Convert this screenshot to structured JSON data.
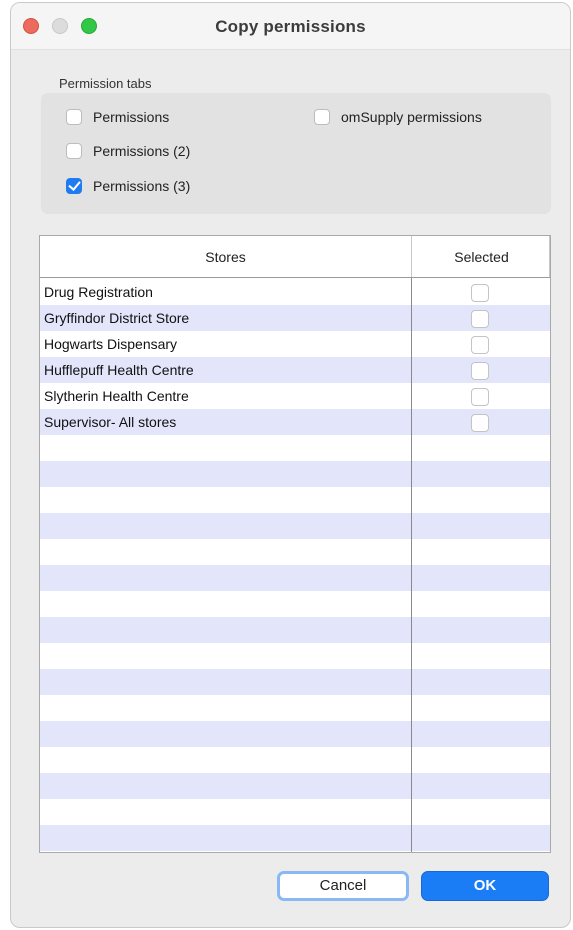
{
  "window": {
    "title": "Copy permissions"
  },
  "permission_tabs": {
    "label": "Permission tabs",
    "options": [
      {
        "label": "Permissions",
        "checked": false
      },
      {
        "label": "Permissions (2)",
        "checked": false
      },
      {
        "label": "Permissions (3)",
        "checked": true
      },
      {
        "label": "omSupply permissions",
        "checked": false
      }
    ]
  },
  "table": {
    "columns": [
      "Stores",
      "Selected"
    ],
    "rows": [
      {
        "store": "Drug Registration",
        "selected": false
      },
      {
        "store": "Gryffindor District Store",
        "selected": false
      },
      {
        "store": "Hogwarts Dispensary",
        "selected": false
      },
      {
        "store": "Hufflepuff Health Centre",
        "selected": false
      },
      {
        "store": "Slytherin Health Centre",
        "selected": false
      },
      {
        "store": "Supervisor- All stores",
        "selected": false
      }
    ]
  },
  "buttons": {
    "cancel": "Cancel",
    "ok": "OK"
  },
  "colors": {
    "accent": "#1a7df5",
    "row_stripe": "#e3e6fb"
  }
}
